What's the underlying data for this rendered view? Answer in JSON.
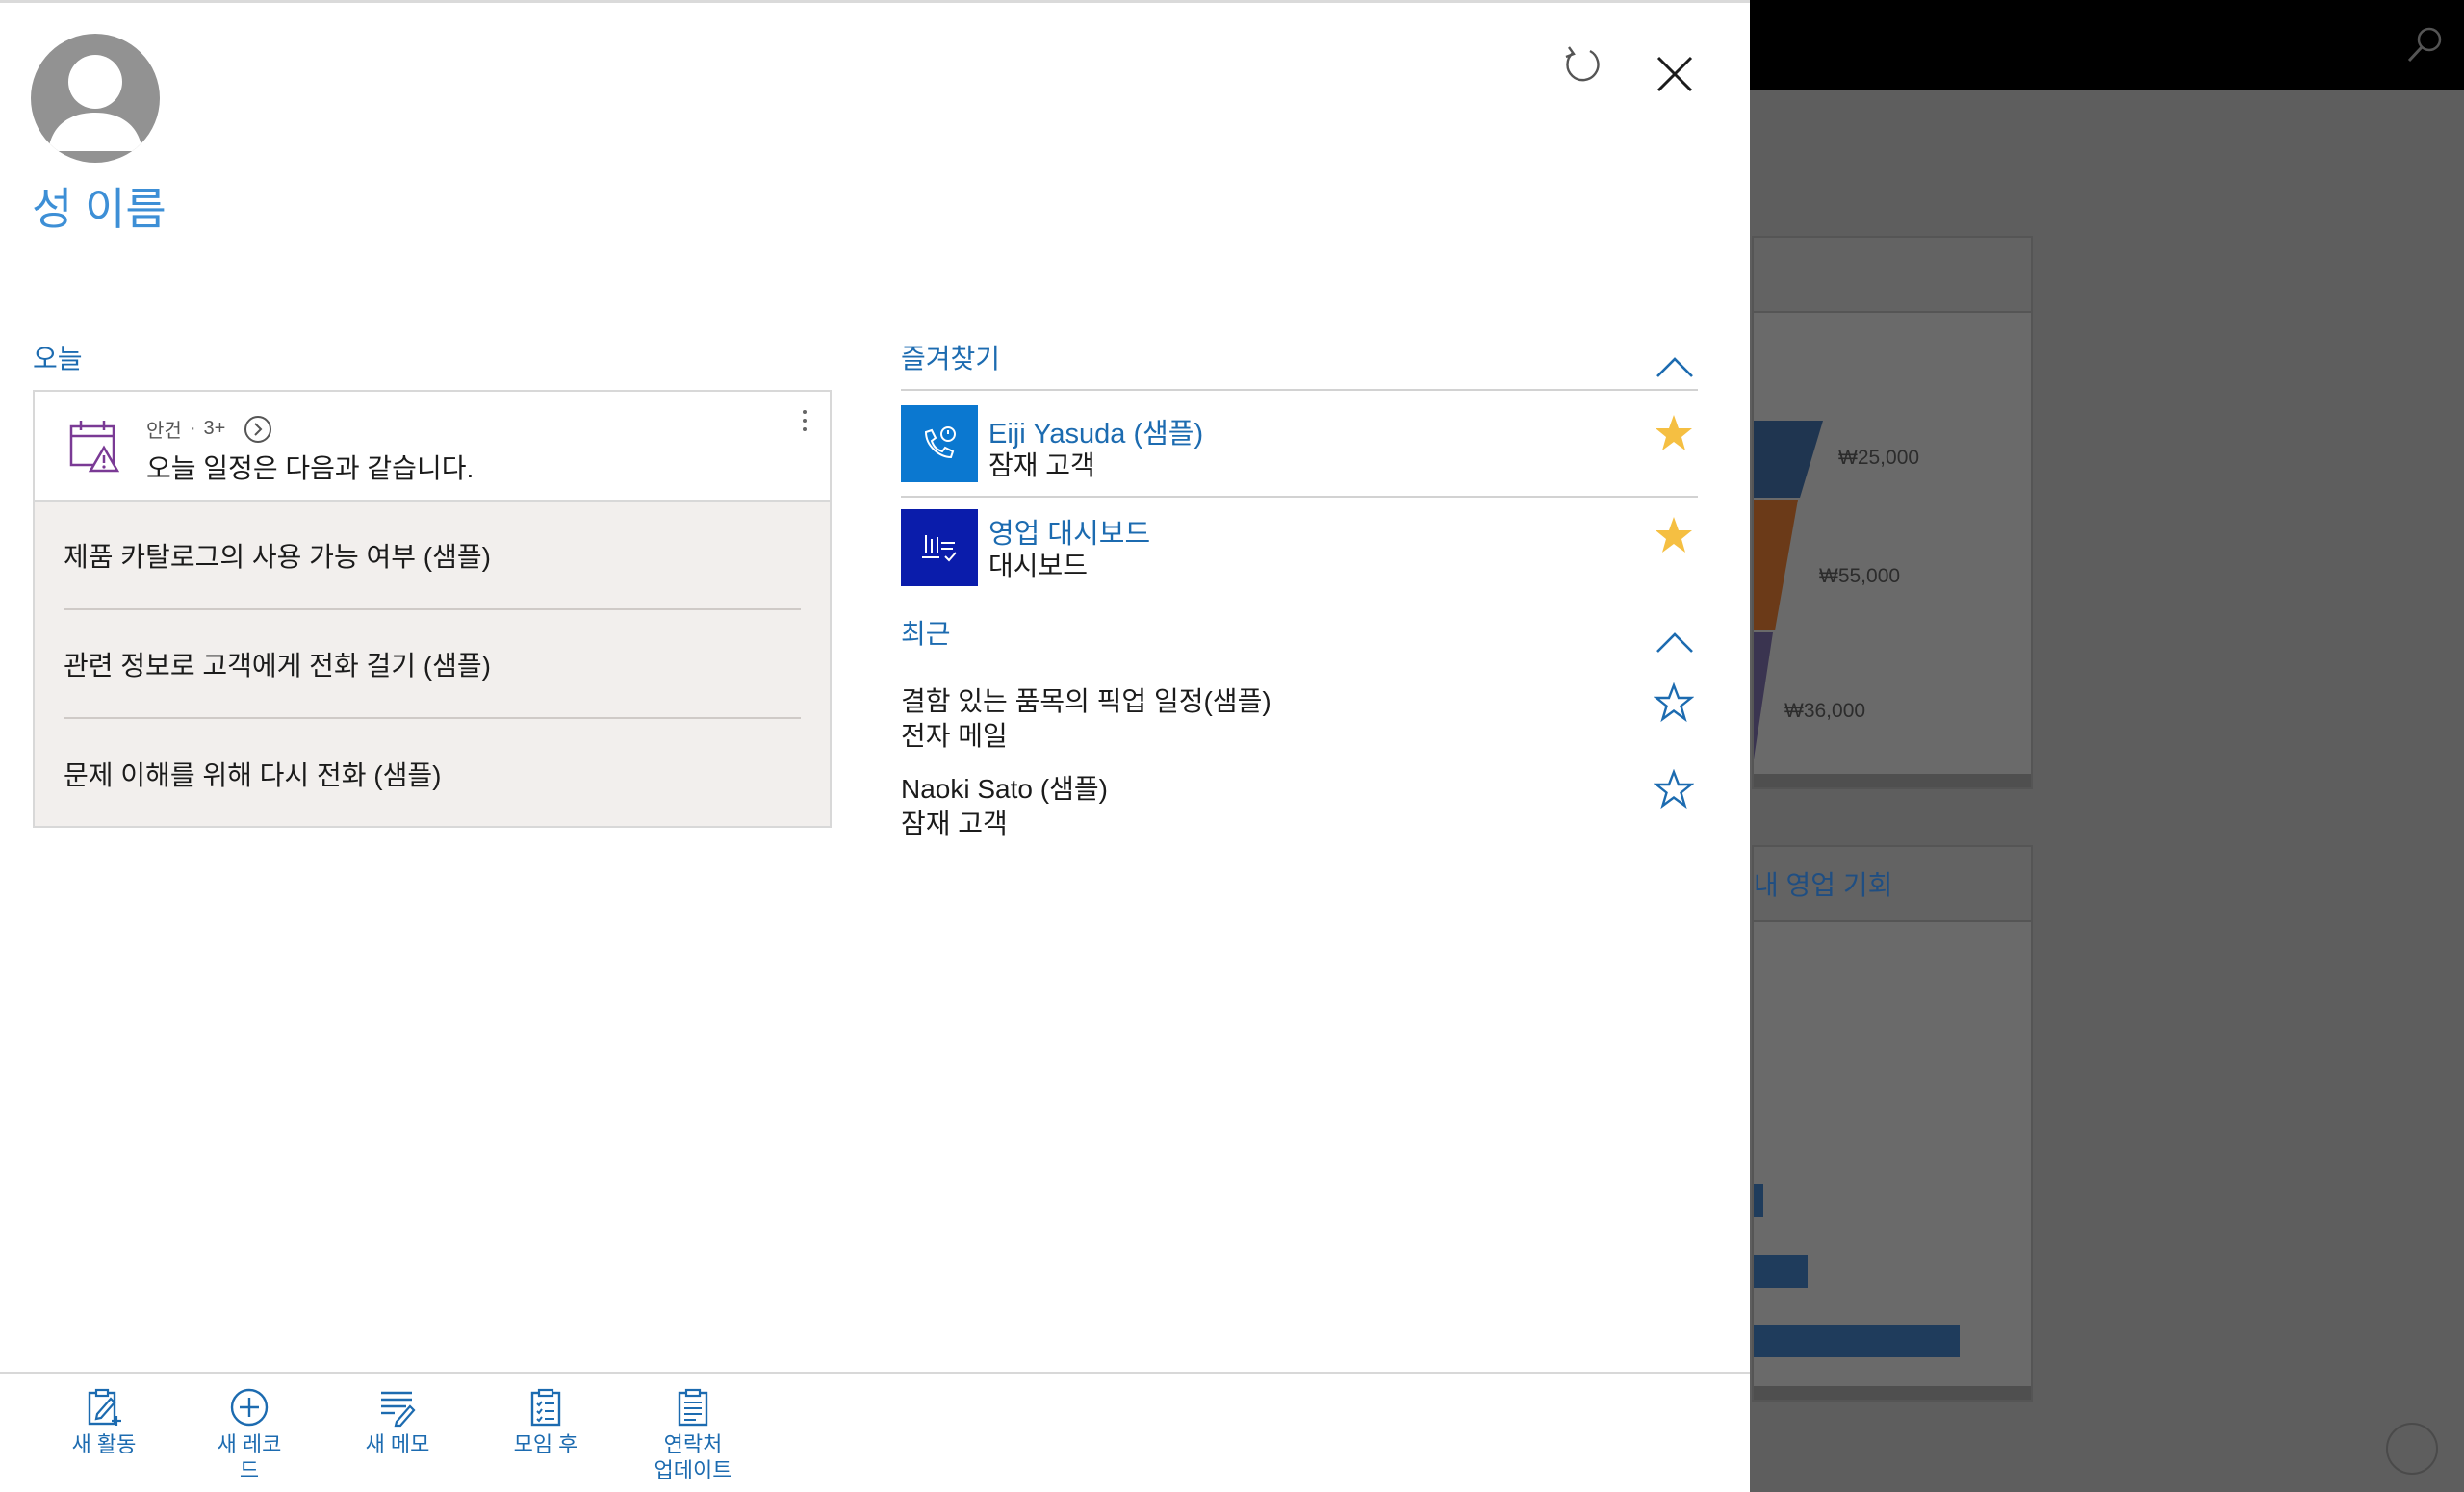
{
  "background": {
    "card_title": "내 영업 기회",
    "funnel_labels": [
      "₩25,000",
      "₩55,000",
      "₩36,000"
    ]
  },
  "user": {
    "name": "성 이름"
  },
  "today": {
    "heading": "오늘",
    "agenda": {
      "type": "안건",
      "separator": "·",
      "count": "3+",
      "text": "오늘 일정은 다음과 같습니다."
    },
    "items": [
      "제품 카탈로그의 사용 가능 여부 (샘플)",
      "관련 정보로 고객에게 전화 걸기 (샘플)",
      "문제 이해를 위해 다시 전화 (샘플)"
    ]
  },
  "favorites": {
    "heading": "즐겨찾기",
    "items": [
      {
        "title": "Eiji Yasuda (샘플)",
        "subtitle": "잠재 고객",
        "tile_color": "#0b78d0",
        "icon": "phone-lead-icon",
        "starred": true
      },
      {
        "title": "영업 대시보드",
        "subtitle": "대시보드",
        "tile_color": "#0a1cab",
        "icon": "dashboard-icon",
        "starred": true
      }
    ]
  },
  "recent": {
    "heading": "최근",
    "items": [
      {
        "title": "결함 있는 품목의 픽업 일정(샘플)",
        "subtitle": "전자 메일",
        "starred": false
      },
      {
        "title": "Naoki Sato (샘플)",
        "subtitle": "잠재 고객",
        "starred": false
      }
    ]
  },
  "actions": [
    {
      "label": "새 활동",
      "icon": "new-activity-icon"
    },
    {
      "label": "새 레코\n드",
      "icon": "new-record-icon"
    },
    {
      "label": "새 메모",
      "icon": "new-note-icon"
    },
    {
      "label": "모임 후",
      "icon": "after-meeting-icon"
    },
    {
      "label": "연락처\n업데이트",
      "icon": "update-contact-icon"
    }
  ],
  "colors": {
    "accent": "#1c6bb0",
    "name": "#3d8fd6",
    "star_filled": "#f5bf42",
    "agenda_icon": "#7a3a95",
    "list_bg": "#f2efed"
  }
}
